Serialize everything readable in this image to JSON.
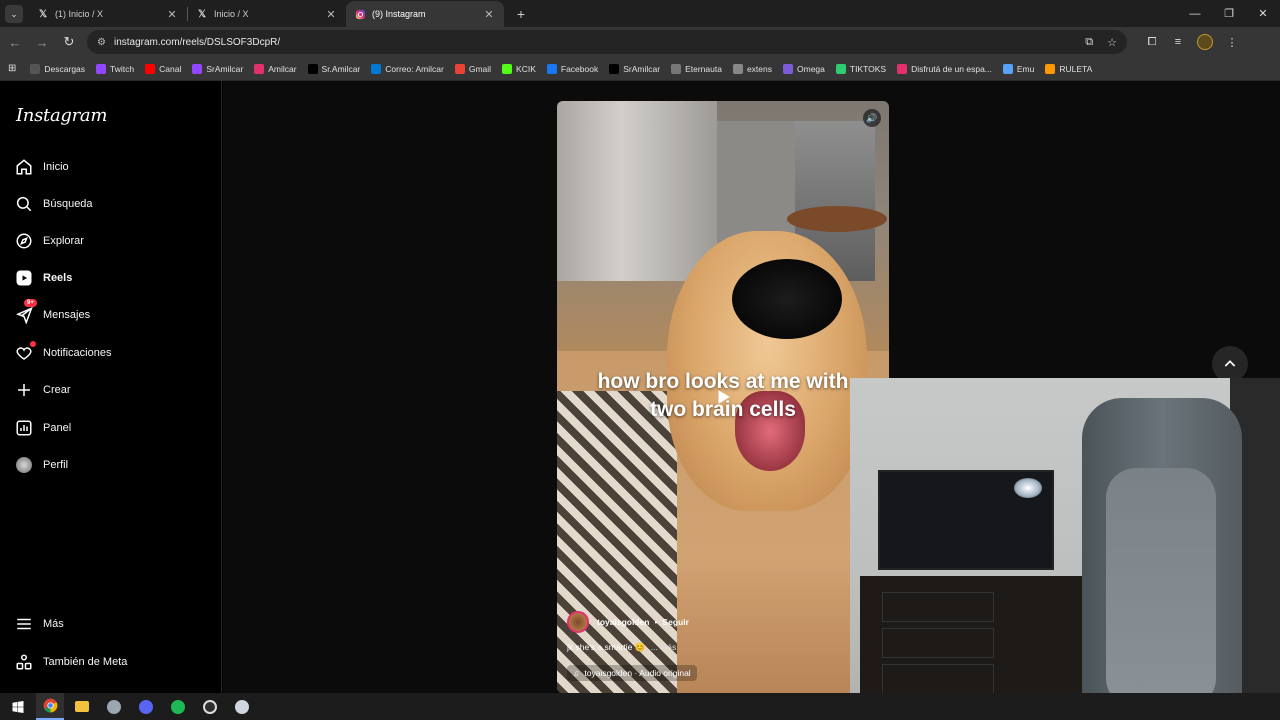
{
  "browser": {
    "tabs": [
      {
        "label": "(1) Inicio / X",
        "icon": "x-logo-icon"
      },
      {
        "label": "Inicio / X",
        "icon": "x-logo-icon"
      },
      {
        "label": "(9) Instagram",
        "icon": "instagram-icon",
        "active": true
      }
    ],
    "url": "instagram.com/reels/DSLSOF3DcpR/",
    "bookmarks": [
      {
        "label": "Descargas",
        "color": "#555555",
        "icon": "download-icon"
      },
      {
        "label": "Twitch",
        "color": "#9146ff",
        "icon": "twitch-icon"
      },
      {
        "label": "Canal",
        "color": "#ff0000",
        "icon": "youtube-icon"
      },
      {
        "label": "SrAmilcar",
        "color": "#9146ff",
        "icon": "twitch-icon"
      },
      {
        "label": "Amilcar",
        "color": "#e1306c",
        "icon": "instagram-icon"
      },
      {
        "label": "Sr.Amilcar",
        "color": "#000000",
        "icon": "x-logo-icon"
      },
      {
        "label": "Correo: Amilcar",
        "color": "#0078d4",
        "icon": "outlook-icon"
      },
      {
        "label": "Gmail",
        "color": "#ea4335",
        "icon": "gmail-icon"
      },
      {
        "label": "KCIK",
        "color": "#53fc18",
        "icon": "kick-icon"
      },
      {
        "label": "Facebook",
        "color": "#1877f2",
        "icon": "facebook-icon"
      },
      {
        "label": "SrAmilcar",
        "color": "#000000",
        "icon": "tiktok-icon"
      },
      {
        "label": "Eternauta",
        "color": "#777777",
        "icon": "page-icon"
      },
      {
        "label": "extens",
        "color": "#888888",
        "icon": "globe-icon"
      },
      {
        "label": "Omega",
        "color": "#7b5cd6",
        "icon": "omega-icon"
      },
      {
        "label": "TIKTOKS",
        "color": "#2ecc71",
        "icon": "drive-icon"
      },
      {
        "label": "Disfrutá de un espa...",
        "color": "#e1306c",
        "icon": "page-icon"
      },
      {
        "label": "Emu",
        "color": "#5aa0ff",
        "icon": "emu-icon"
      },
      {
        "label": "RULETA",
        "color": "#ff9800",
        "icon": "ruleta-icon"
      }
    ]
  },
  "instagram": {
    "logo": "Instagram",
    "nav": [
      {
        "label": "Inicio",
        "icon": "home-icon"
      },
      {
        "label": "Búsqueda",
        "icon": "search-icon"
      },
      {
        "label": "Explorar",
        "icon": "compass-icon"
      },
      {
        "label": "Reels",
        "icon": "reels-icon",
        "bold": true
      },
      {
        "label": "Mensajes",
        "icon": "messenger-icon",
        "badge": "9+"
      },
      {
        "label": "Notificaciones",
        "icon": "heart-icon",
        "dot": true
      },
      {
        "label": "Crear",
        "icon": "plus-icon"
      },
      {
        "label": "Panel",
        "icon": "chart-icon"
      },
      {
        "label": "Perfil",
        "icon": "avatar-icon"
      }
    ],
    "more": "Más",
    "meta": "También de Meta"
  },
  "reel": {
    "overlay_line1": "how bro looks at me with",
    "overlay_line2": "two brain cells",
    "username": "toyaisgolden",
    "separator": "•",
    "follow": "Seguir",
    "caption": "jk she's a smartie 😊",
    "more": "... más",
    "audio": "toyaisgolden · Audio original"
  },
  "colors": {
    "accent_badge": "#ff3040",
    "sidebar_bg": "#000000",
    "main_bg": "#0b0b0b"
  }
}
